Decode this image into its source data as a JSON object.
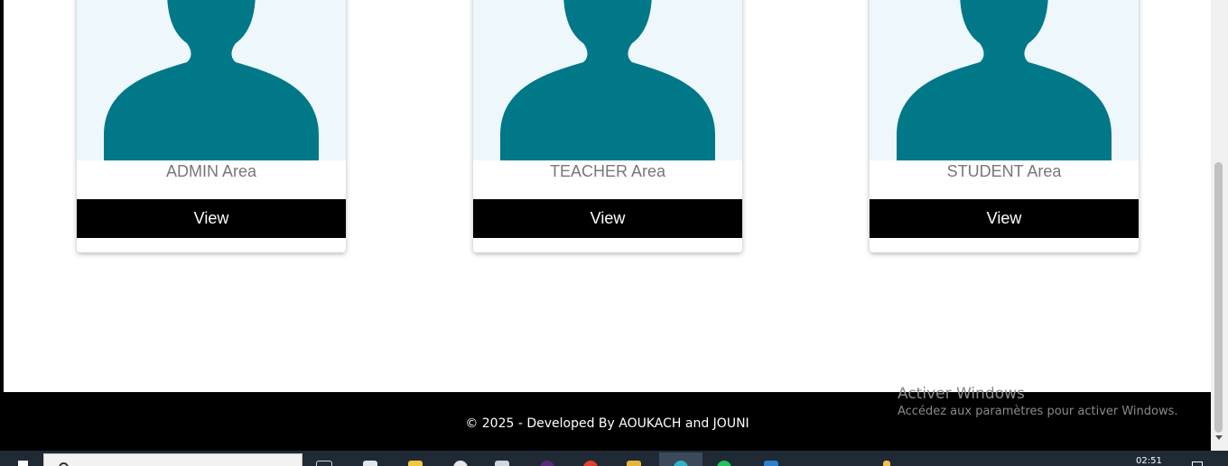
{
  "cards": [
    {
      "title": "ADMIN Area",
      "button_label": "View"
    },
    {
      "title": "TEACHER Area",
      "button_label": "View"
    },
    {
      "title": "STUDENT Area",
      "button_label": "View"
    }
  ],
  "colors": {
    "silhouette": "#007888",
    "photo_bg": "#eef7fb",
    "button_bg": "#000000",
    "footer_bg": "#000000"
  },
  "footer": {
    "copyright": "© 2025 - Developed By AOUKACH and JOUNI"
  },
  "watermark": {
    "title": "Activer Windows",
    "subtitle": "Accédez aux paramètres pour activer Windows."
  },
  "taskbar": {
    "clock": "02:51",
    "icons": [
      "start-icon",
      "search-icon",
      "task-view-icon",
      "notepad-icon",
      "sticky-icon",
      "paint-icon",
      "window-icon",
      "app-icon",
      "chrome-icon",
      "folder-icon",
      "browser-icon",
      "whatsapp-icon",
      "vscode-icon",
      "file-icon",
      "notification-icon"
    ]
  }
}
